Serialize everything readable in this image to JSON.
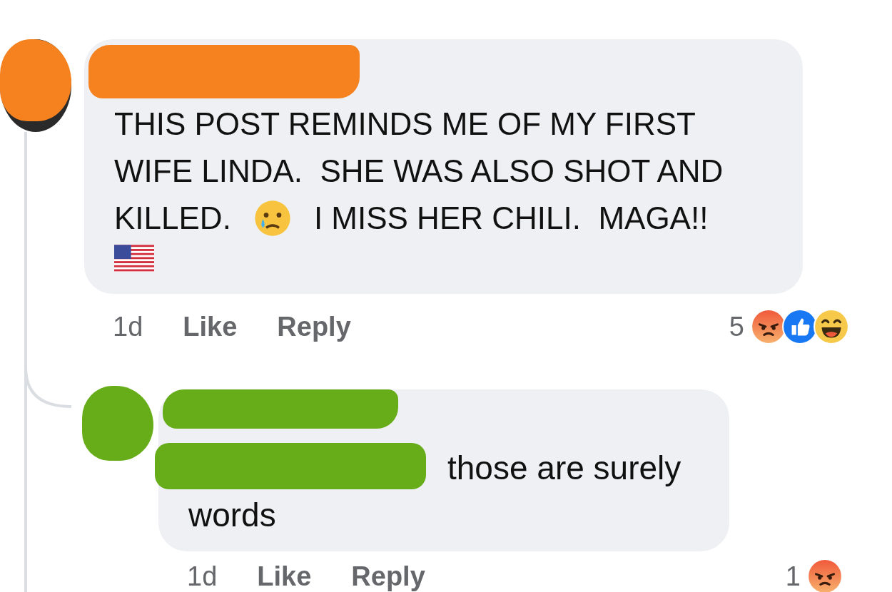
{
  "comments": [
    {
      "color": "#f5821f",
      "lines": [
        [
          {
            "kind": "text",
            "text": "THIS POST REMINDS ME OF MY FIRST"
          }
        ],
        [
          {
            "kind": "text",
            "text": "WIFE LINDA.  SHE WAS ALSO SHOT AND"
          }
        ],
        [
          {
            "kind": "text",
            "text": "KILLED."
          },
          {
            "kind": "sad_face"
          },
          {
            "kind": "text",
            "text": "I MISS HER CHILI.  MAGA!!"
          }
        ],
        [
          {
            "kind": "flag"
          }
        ]
      ],
      "time": "1d",
      "like": "Like",
      "reply": "Reply",
      "reaction_count": "5",
      "reactions": [
        {
          "kind": "angry"
        },
        {
          "kind": "like"
        },
        {
          "kind": "haha"
        }
      ]
    },
    {
      "color": "#67ad19",
      "lines": [
        [
          {
            "kind": "text",
            "text": "those are surely words"
          }
        ]
      ],
      "time": "1d",
      "like": "Like",
      "reply": "Reply",
      "reaction_count": "1",
      "reactions": [
        {
          "kind": "angry"
        }
      ]
    }
  ]
}
